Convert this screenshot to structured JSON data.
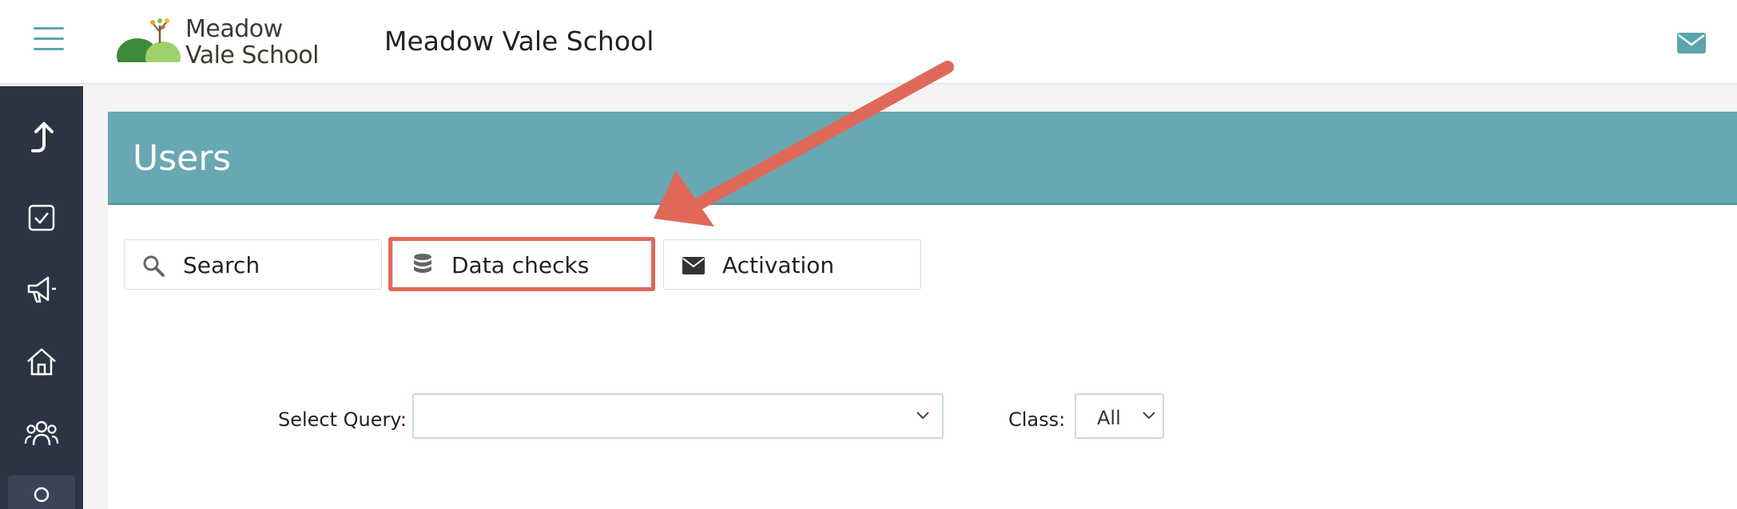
{
  "header": {
    "logo_line1": "Meadow",
    "logo_line2": "Vale School",
    "school_name": "Meadow Vale School"
  },
  "icons": {
    "menu": "hamburger-menu-icon",
    "mail": "envelope-icon",
    "sidebar": [
      "upload-arrow-icon",
      "checkbox-icon",
      "megaphone-icon",
      "home-icon",
      "users-icon",
      "user-icon"
    ]
  },
  "page": {
    "title": "Users"
  },
  "tabs": [
    {
      "label": "Search",
      "icon": "search-icon"
    },
    {
      "label": "Data checks",
      "icon": "database-icon"
    },
    {
      "label": "Activation",
      "icon": "envelope-icon"
    }
  ],
  "filters": {
    "query_label": "Select Query:",
    "query_value": "",
    "class_label": "Class:",
    "class_value": "All"
  },
  "colors": {
    "accent": "#68a8b2",
    "sidebar": "#2c3444",
    "annotation": "#e06858"
  }
}
